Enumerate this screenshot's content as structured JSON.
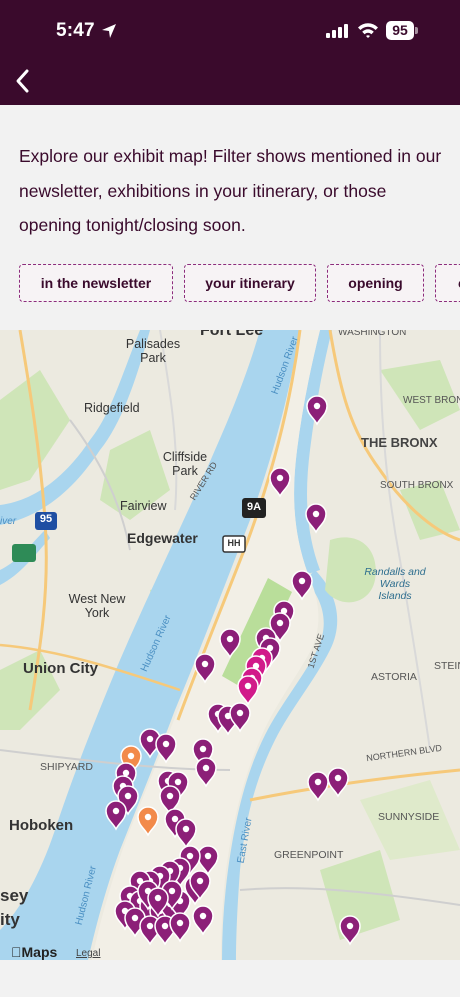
{
  "status_bar": {
    "time": "5:47",
    "battery": "95"
  },
  "nav": {
    "back_icon": "chevron-left-icon"
  },
  "intro_text": "Explore our exhibit map! Filter shows mentioned in our newsletter, exhibitions in your itinerary, or those opening tonight/closing soon.",
  "filters": [
    {
      "label": "in the newsletter"
    },
    {
      "label": "your itinerary"
    },
    {
      "label": "opening"
    },
    {
      "label": "c"
    }
  ],
  "map": {
    "attribution": "Maps",
    "legal": "Legal",
    "labels": {
      "fort_lee": "Fort Lee",
      "washington": "WASHINGTON",
      "palisades_park": "Palisades Park",
      "ridgefield": "Ridgefield",
      "west_bronx": "WEST BRONX",
      "the_bronx": "THE BRONX",
      "hudson_river_north": "Hudson River",
      "cliffside_park": "Cliffside Park",
      "river_rd": "RIVER RD",
      "south_bronx": "SOUTH BRONX",
      "fairview": "Fairview",
      "route_95": "95",
      "route_9a": "9A",
      "river_edge": "iver",
      "edgewater": "Edgewater",
      "route_hh": "HH",
      "randalls": "Randalls and Wards Islands",
      "west_new_york": "West New York",
      "hudson_river_mid": "Hudson River",
      "first_ave": "1ST AVE",
      "union_city": "Union City",
      "astoria": "ASTORIA",
      "stein": "STEIN",
      "northern_blvd": "NORTHERN BLVD",
      "shipyard": "SHIPYARD",
      "hoboken": "Hoboken",
      "sunnyside": "SUNNYSIDE",
      "east_river": "East River",
      "greenpoint": "GREENPOINT",
      "hudson_river_south": "Hudson River",
      "jersey": "sey",
      "city": "ity"
    },
    "colors": {
      "pin_purple": "#8c1f78",
      "pin_magenta": "#d11a8a",
      "pin_orange": "#f28a4a",
      "water": "#a9d5ee",
      "park": "#b9de9a"
    }
  }
}
